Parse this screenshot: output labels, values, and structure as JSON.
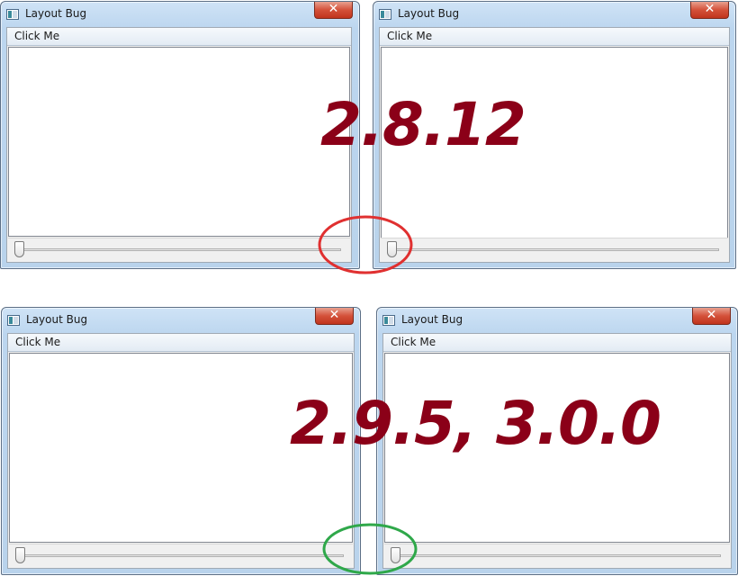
{
  "windows": [
    {
      "title": "Layout Bug",
      "close_glyph": "✕",
      "menu": "Click Me"
    },
    {
      "title": "Layout Bug",
      "close_glyph": "✕",
      "menu": "Click Me"
    },
    {
      "title": "Layout Bug",
      "close_glyph": "✕",
      "menu": "Click Me"
    },
    {
      "title": "Layout Bug",
      "close_glyph": "✕",
      "menu": "Click Me"
    }
  ],
  "annotations": {
    "top_version": "2.8.12",
    "bottom_version": "2.9.5, 3.0.0",
    "top_circle_color": "#e03030",
    "bottom_circle_color": "#2fa84a",
    "version_color": "#8b0018"
  },
  "sliders": {
    "value_fraction": 0.0
  }
}
